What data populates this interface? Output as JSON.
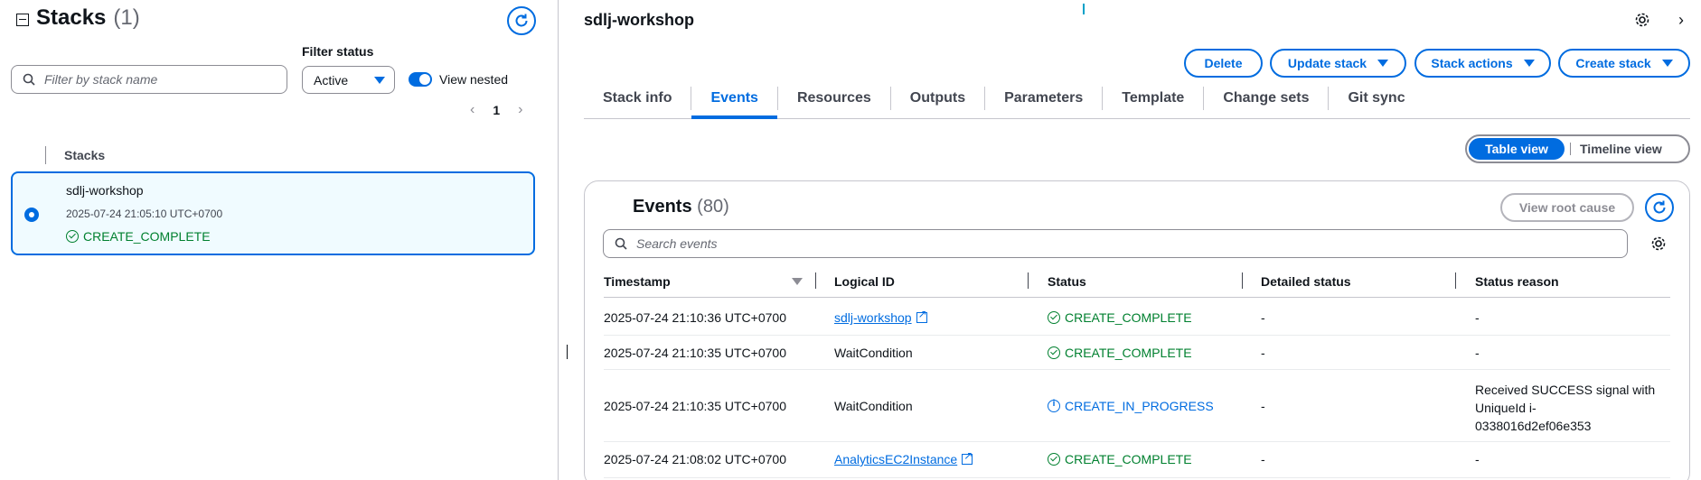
{
  "left": {
    "title": "Stacks",
    "count": "(1)",
    "filter_placeholder": "Filter by stack name",
    "filter_status_label": "Filter status",
    "filter_status_value": "Active",
    "view_nested_label": "View nested",
    "page_number": "1",
    "stacks_header": "Stacks",
    "stacks": [
      {
        "name": "sdlj-workshop",
        "date": "2025-07-24 21:05:10 UTC+0700",
        "status": "CREATE_COMPLETE"
      }
    ]
  },
  "right": {
    "title": "sdlj-workshop",
    "buttons": {
      "delete": "Delete",
      "update": "Update stack",
      "actions": "Stack actions",
      "create": "Create stack"
    },
    "tabs": [
      "Stack info",
      "Events",
      "Resources",
      "Outputs",
      "Parameters",
      "Template",
      "Change sets",
      "Git sync"
    ],
    "active_tab": "Events",
    "view_toggle": {
      "table": "Table view",
      "timeline": "Timeline view",
      "selected": "Table view"
    },
    "events": {
      "title": "Events",
      "count": "(80)",
      "root_cause_button": "View root cause",
      "search_placeholder": "Search events",
      "columns": [
        "Timestamp",
        "Logical ID",
        "Status",
        "Detailed status",
        "Status reason"
      ],
      "rows": [
        {
          "timestamp": "2025-07-24 21:10:36 UTC+0700",
          "logical_id": "sdlj-workshop",
          "logical_link": true,
          "status": "CREATE_COMPLETE",
          "detailed": "-",
          "reason": "-"
        },
        {
          "timestamp": "2025-07-24 21:10:35 UTC+0700",
          "logical_id": "WaitCondition",
          "logical_link": false,
          "status": "CREATE_COMPLETE",
          "detailed": "-",
          "reason": "-"
        },
        {
          "timestamp": "2025-07-24 21:10:35 UTC+0700",
          "logical_id": "WaitCondition",
          "logical_link": false,
          "status": "CREATE_IN_PROGRESS",
          "detailed": "-",
          "reason_lines": [
            "Received SUCCESS signal with",
            "UniqueId i-",
            "0338016d2ef06e353"
          ]
        },
        {
          "timestamp": "2025-07-24 21:08:02 UTC+0700",
          "logical_id": "AnalyticsEC2Instance",
          "logical_link": true,
          "status": "CREATE_COMPLETE",
          "detailed": "-",
          "reason": "-"
        }
      ]
    }
  },
  "colors": {
    "accent": "#006ce0",
    "success": "#00802f",
    "border": "#c6c6cd"
  }
}
